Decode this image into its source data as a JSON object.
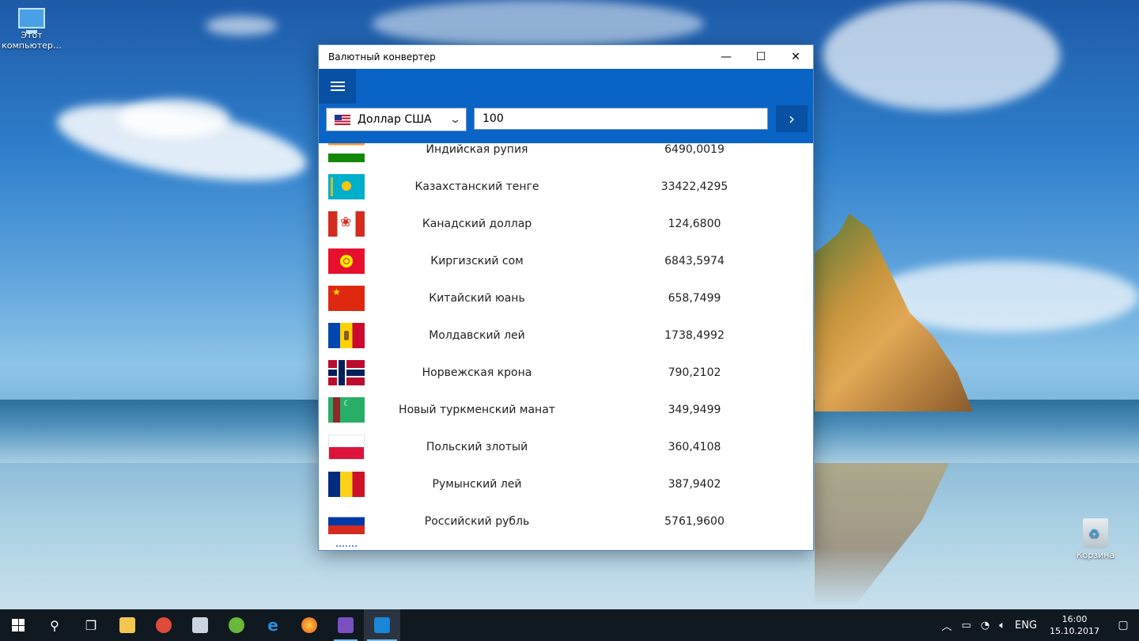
{
  "desktop": {
    "icons": [
      {
        "label": "Этот компьютер…"
      },
      {
        "label": "Корзина"
      }
    ]
  },
  "window": {
    "title": "Валютный конвертер",
    "controls": {
      "minimize": "—",
      "maximize": "☐",
      "close": "✕"
    }
  },
  "converter": {
    "currency_selected": "Доллар США",
    "amount": "100",
    "go_glyph": "›"
  },
  "rates": [
    {
      "name": "Индийская рупия",
      "value": "6490,0019",
      "flag": "in"
    },
    {
      "name": "Казахстанский тенге",
      "value": "33422,4295",
      "flag": "kz"
    },
    {
      "name": "Канадский доллар",
      "value": "124,6800",
      "flag": "ca"
    },
    {
      "name": "Киргизский сом",
      "value": "6843,5974",
      "flag": "kg"
    },
    {
      "name": "Китайский юань",
      "value": "658,7499",
      "flag": "cn"
    },
    {
      "name": "Молдавский лей",
      "value": "1738,4992",
      "flag": "md"
    },
    {
      "name": "Норвежская крона",
      "value": "790,2102",
      "flag": "no"
    },
    {
      "name": "Новый туркменский манат",
      "value": "349,9499",
      "flag": "tm"
    },
    {
      "name": "Польский злотый",
      "value": "360,4108",
      "flag": "pl"
    },
    {
      "name": "Румынский лей",
      "value": "387,9402",
      "flag": "ro"
    },
    {
      "name": "Российский рубль",
      "value": "5761,9600",
      "flag": "ru"
    }
  ],
  "taskbar": {
    "apps": [
      {
        "icon": "search-icon"
      },
      {
        "icon": "task-view-icon"
      },
      {
        "icon": "file-explorer-icon"
      },
      {
        "icon": "ccleaner-icon"
      },
      {
        "icon": "paint-icon"
      },
      {
        "icon": "utorrent-icon"
      },
      {
        "icon": "edge-icon"
      },
      {
        "icon": "firefox-icon"
      },
      {
        "icon": "visual-studio-icon"
      },
      {
        "icon": "currency-converter-icon"
      }
    ],
    "language": "ENG",
    "time": "16:00",
    "date": "15.10.2017"
  },
  "colors": {
    "accent": "#0a64c6",
    "accent_dark": "#0850a4"
  }
}
